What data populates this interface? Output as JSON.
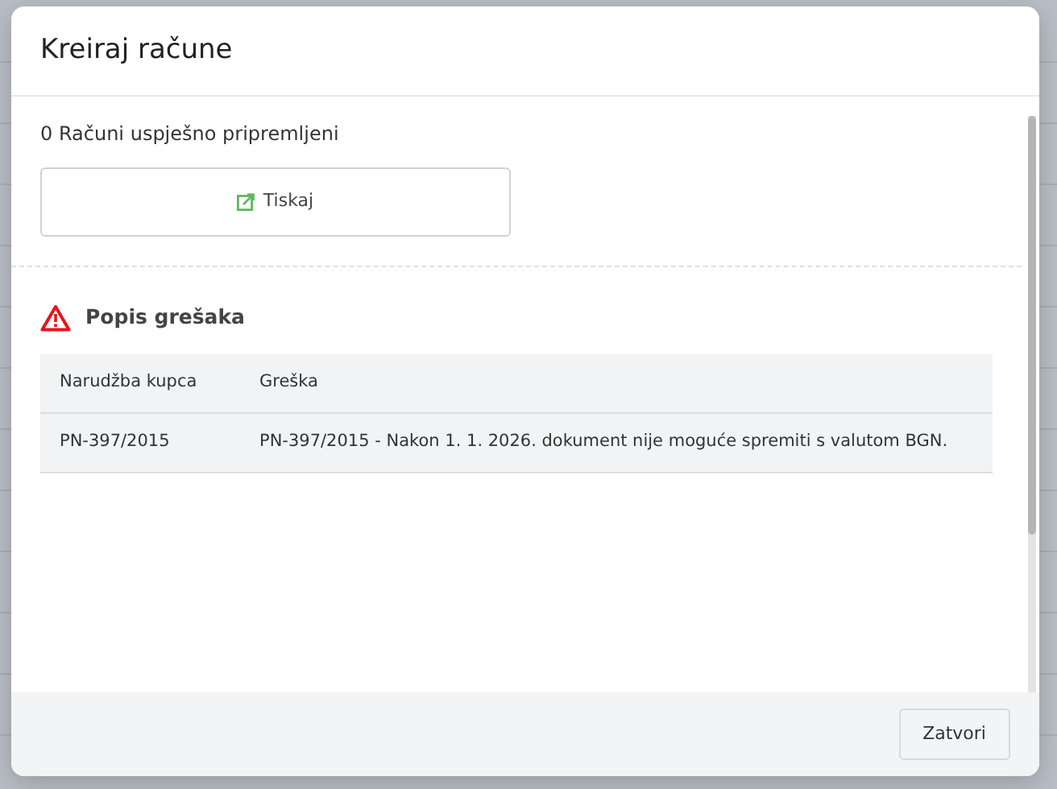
{
  "dialog": {
    "title": "Kreiraj račune"
  },
  "summary": {
    "text": "0 Računi uspješno pripremljeni",
    "print_button": "Tiskaj"
  },
  "errors": {
    "title": "Popis grešaka",
    "table": {
      "columns": [
        "Narudžba kupca",
        "Greška"
      ],
      "rows": [
        [
          "PN-397/2015",
          "PN-397/2015 - Nakon 1. 1. 2026. dokument nije moguće spremiti s valutom BGN."
        ]
      ]
    }
  },
  "footer": {
    "buttons": [
      "Zatvori"
    ]
  }
}
